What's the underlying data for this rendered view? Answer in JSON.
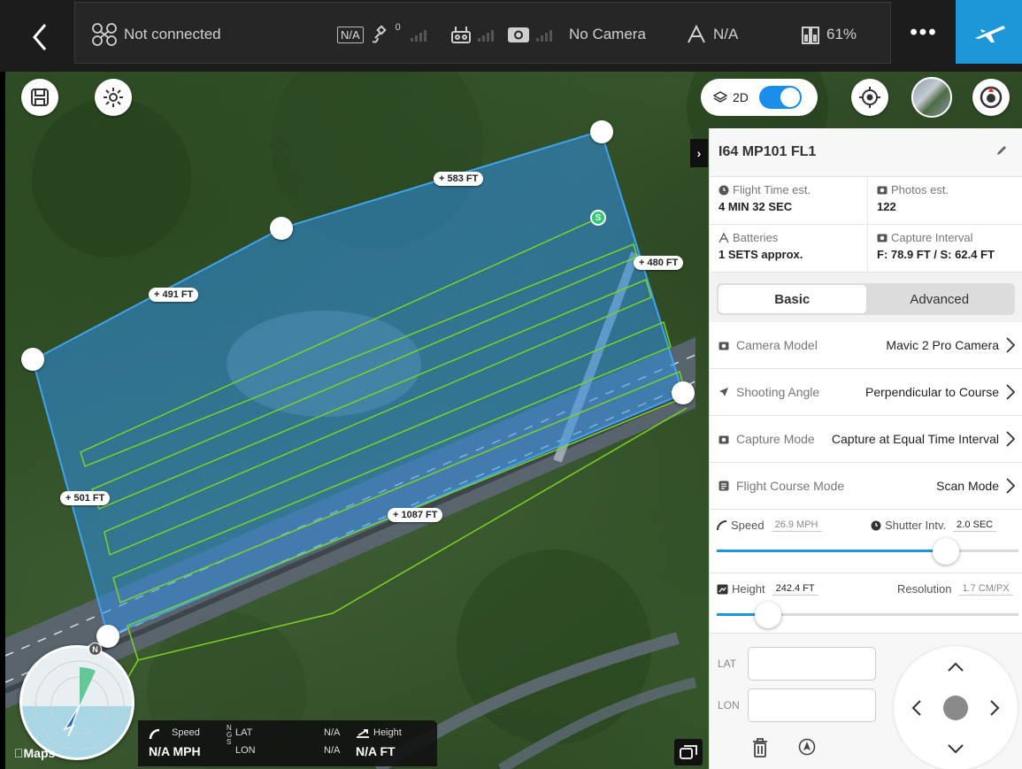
{
  "topbar": {
    "connection_label": "Not connected",
    "gps_na": "N/A",
    "gps_count": "0",
    "camera_label": "No Camera",
    "rth_value": "N/A",
    "battery_value": "61%",
    "more_label": "•••"
  },
  "map": {
    "toggle_label": "2D",
    "distances": [
      "583 FT",
      "480 FT",
      "491 FT",
      "501 FT",
      "1087 FT"
    ],
    "attribution": "Maps",
    "start_label": "S",
    "compass_n": "N"
  },
  "telemetry": {
    "speed_label": "Speed",
    "speed_value": "N/A MPH",
    "lat_label": "LAT",
    "lat_value": "N/A",
    "lon_label": "LON",
    "lon_value": "N/A",
    "height_label": "Height",
    "height_value": "N/A FT",
    "gps_letters": "N\nG\nS"
  },
  "panel": {
    "mission_name": "I64 MP101 FL1",
    "stats": [
      {
        "label": "Flight Time est.",
        "value": "4 MIN 32 SEC",
        "icon": "clock-icon"
      },
      {
        "label": "Photos est.",
        "value": "122",
        "icon": "camera-icon"
      },
      {
        "label": "Batteries",
        "value": "1 SETS approx.",
        "icon": "battery-icon"
      },
      {
        "label": "Capture Interval",
        "value": "F: 78.9 FT / S: 62.4 FT",
        "icon": "camera-icon"
      }
    ],
    "tabs": [
      "Basic",
      "Advanced"
    ],
    "rows": [
      {
        "label": "Camera Model",
        "value": "Mavic 2 Pro Camera"
      },
      {
        "label": "Shooting Angle",
        "value": "Perpendicular to Course"
      },
      {
        "label": "Capture Mode",
        "value": "Capture at Equal Time Interval"
      },
      {
        "label": "Flight Course Mode",
        "value": "Scan Mode"
      }
    ],
    "speed": {
      "label": "Speed",
      "value": "26.9 MPH",
      "shutter_label": "Shutter Intv.",
      "shutter_value": "2.0 SEC",
      "fraction": 0.76
    },
    "height": {
      "label": "Height",
      "value": "242.4 FT",
      "resolution_label": "Resolution",
      "resolution_value": "1.7 CM/PX",
      "fraction": 0.17
    },
    "coords": {
      "lat_label": "LAT",
      "lon_label": "LON",
      "lat_value": "",
      "lon_value": ""
    }
  },
  "colors": {
    "accent": "#1e97d8",
    "polygon": "#2f8fe6",
    "flightline": "#7ed321"
  }
}
